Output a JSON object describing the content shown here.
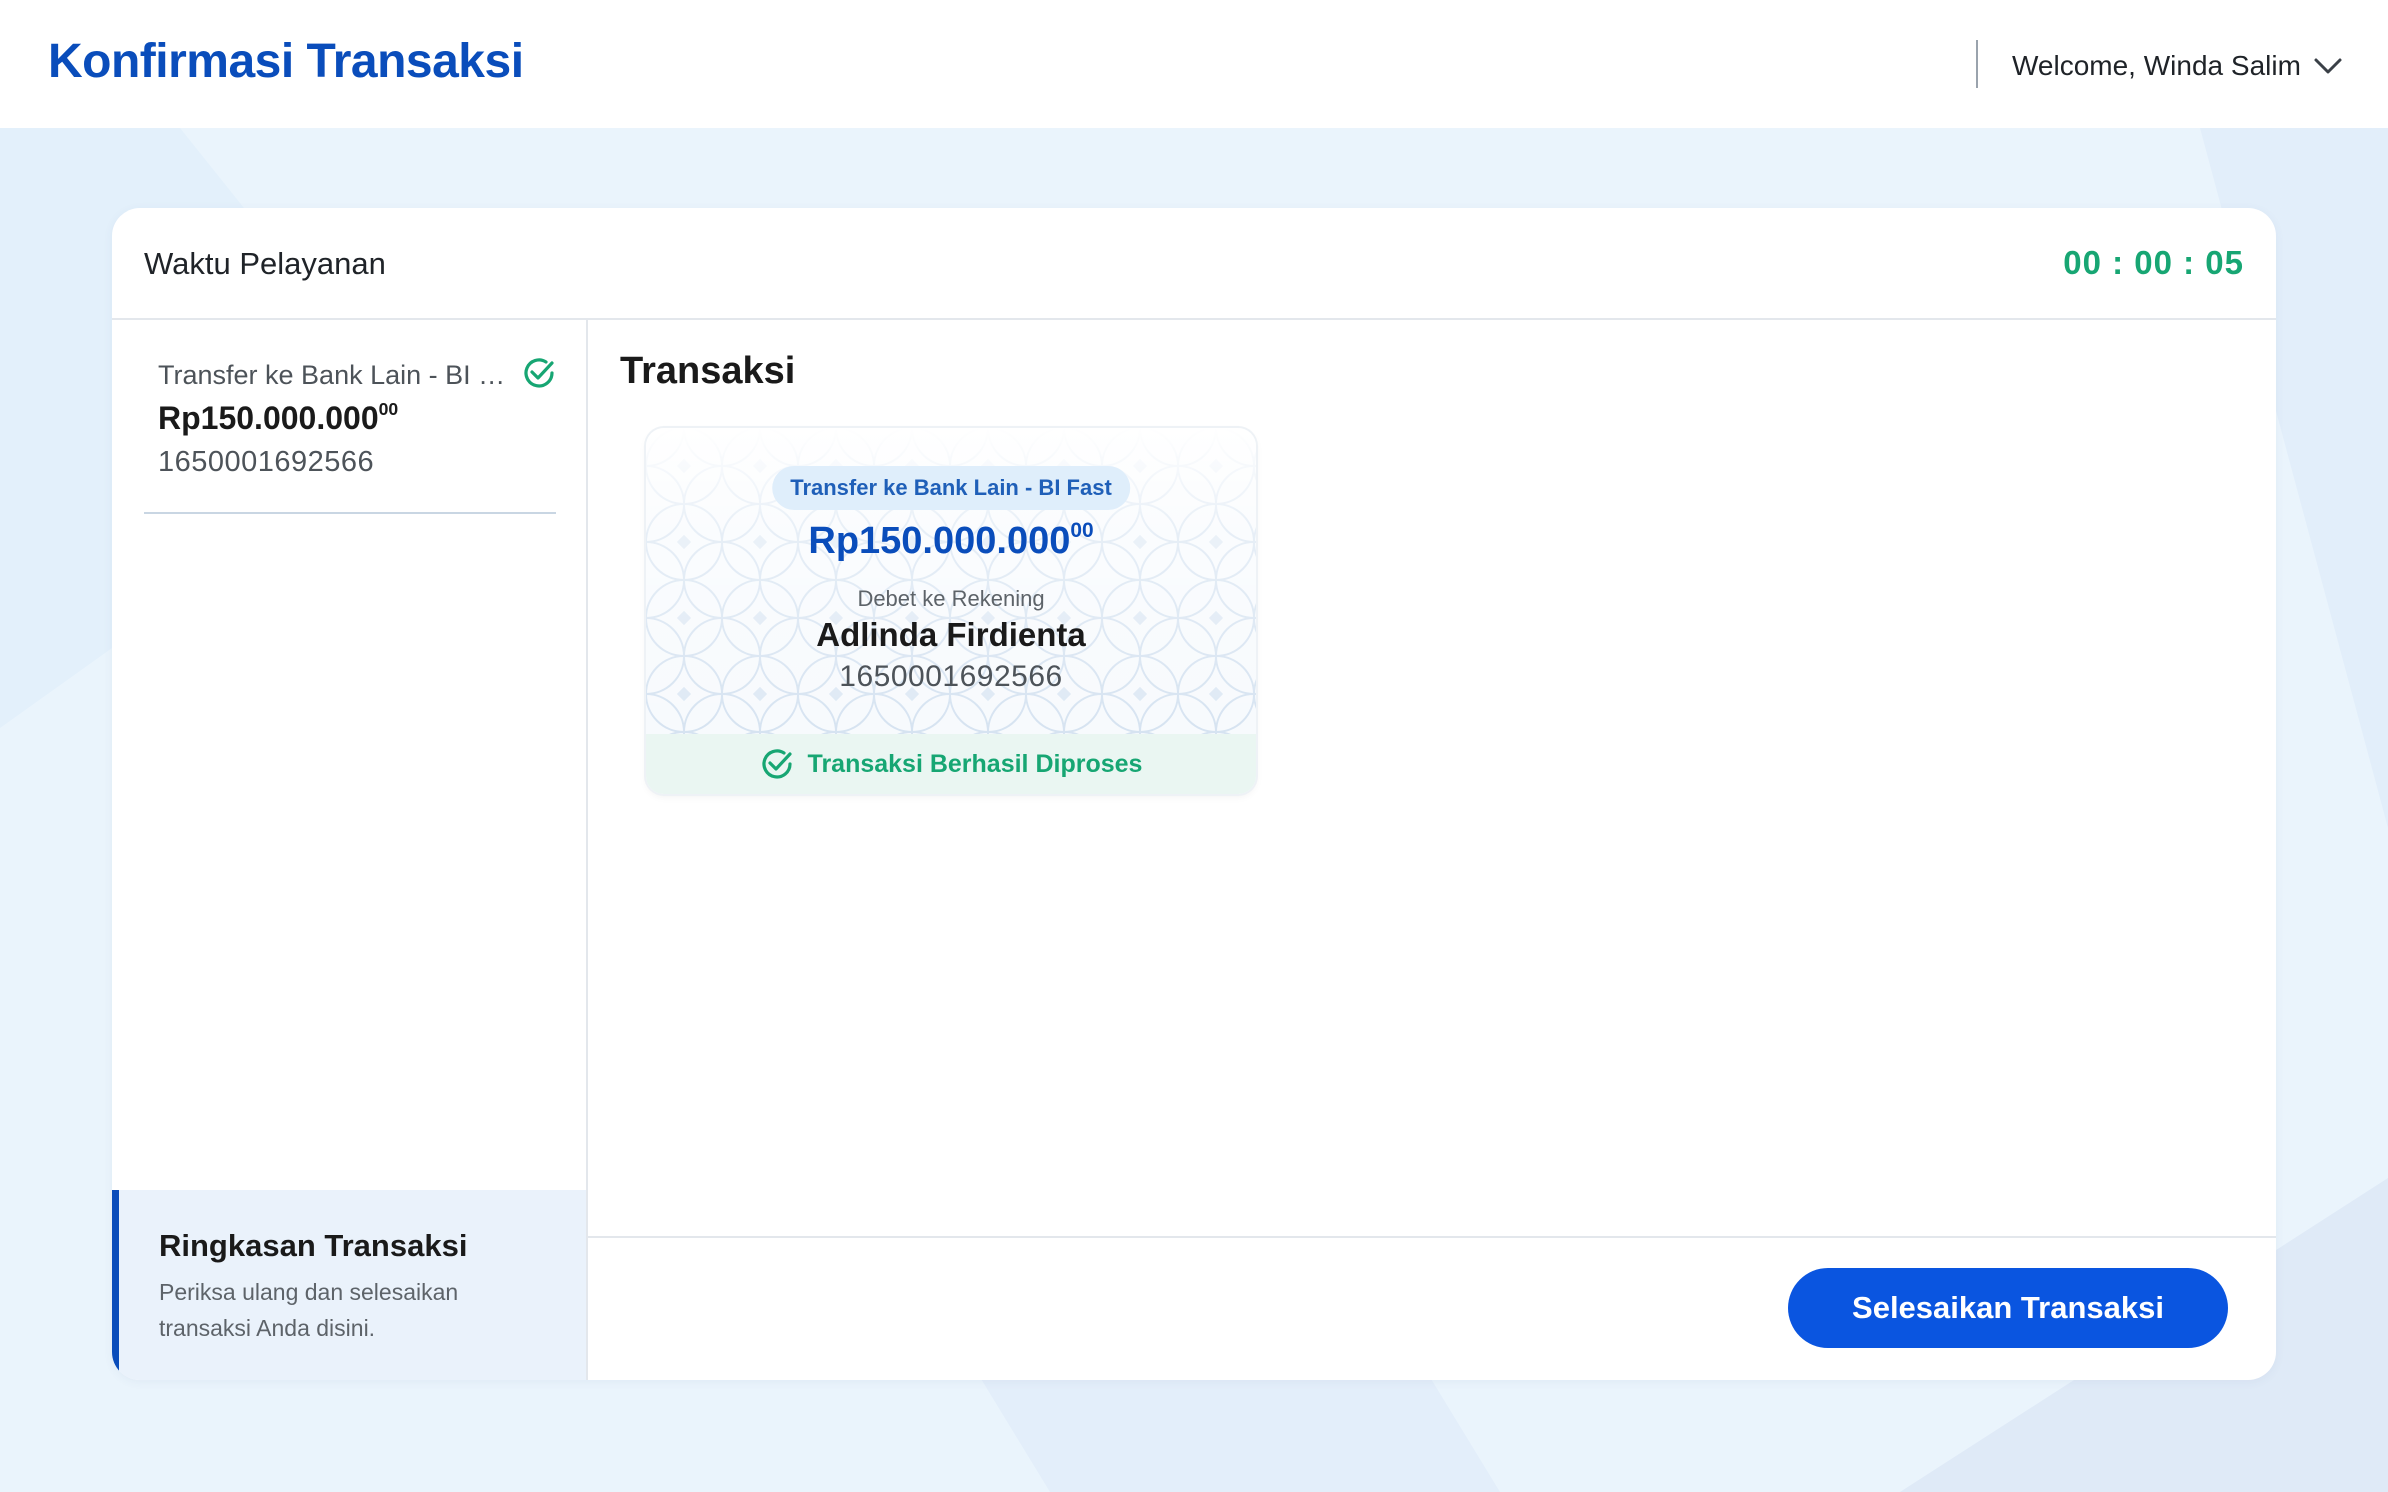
{
  "header": {
    "title": "Konfirmasi Transaksi",
    "welcome": "Welcome, Winda Salim"
  },
  "service": {
    "label": "Waktu Pelayanan",
    "timer": "00 : 00 : 05"
  },
  "sidebar": {
    "items": [
      {
        "title": "Transfer ke Bank Lain - BI Fast",
        "amount_main": "Rp150.000.000",
        "amount_decimal": "00",
        "account": "1650001692566",
        "status": "success"
      }
    ],
    "summary": {
      "title": "Ringkasan Transaksi",
      "description": "Periksa ulang dan selesaikan transaksi Anda disini."
    }
  },
  "main": {
    "title": "Transaksi",
    "transaction": {
      "type": "Transfer ke Bank Lain - BI Fast",
      "amount_main": "Rp150.000.000",
      "amount_decimal": "00",
      "debit_label": "Debet ke Rekening",
      "owner": "Adlinda Firdienta",
      "account": "1650001692566",
      "status_text": "Transaksi Berhasil Diproses"
    }
  },
  "footer": {
    "finish_label": "Selesaikan Transaksi"
  },
  "colors": {
    "brand": "#0a4dbb",
    "button": "#0a55e0",
    "success": "#17a673"
  }
}
